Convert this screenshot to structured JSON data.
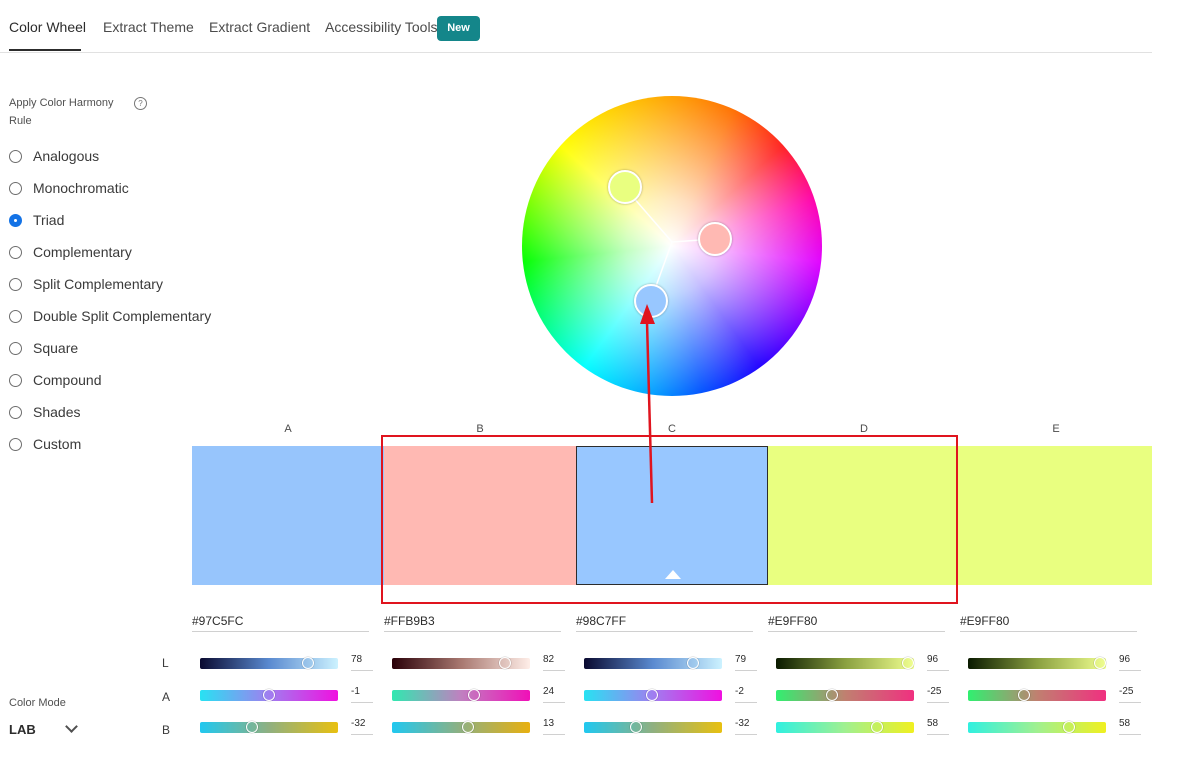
{
  "tabs": [
    {
      "label": "Color Wheel",
      "active": true
    },
    {
      "label": "Extract Theme",
      "active": false
    },
    {
      "label": "Extract Gradient",
      "active": false
    },
    {
      "label": "Accessibility Tools",
      "active": false
    }
  ],
  "tabs_badge": "New",
  "harmony": {
    "label": "Apply Color Harmony Rule",
    "help_icon": "question-circle-icon",
    "selected": "Triad",
    "rules": [
      "Analogous",
      "Monochromatic",
      "Triad",
      "Complementary",
      "Split Complementary",
      "Double Split Complementary",
      "Square",
      "Compound",
      "Shades",
      "Custom"
    ]
  },
  "swatches": [
    {
      "letter": "A",
      "hex": "#97C5FC",
      "color": "#97C5FC",
      "L": 78,
      "A": -1,
      "B": -32
    },
    {
      "letter": "B",
      "hex": "#FFB9B3",
      "color": "#FFB9B3",
      "L": 82,
      "A": 24,
      "B": 13
    },
    {
      "letter": "C",
      "hex": "#98C7FF",
      "color": "#98C7FF",
      "L": 79,
      "A": -2,
      "B": -32
    },
    {
      "letter": "D",
      "hex": "#E9FF80",
      "color": "#E9FF80",
      "L": 96,
      "A": -25,
      "B": 58
    },
    {
      "letter": "E",
      "hex": "#E9FF80",
      "color": "#E9FF80",
      "L": 96,
      "A": -25,
      "B": 58
    }
  ],
  "selected_swatch": "C",
  "channel_labels": [
    "L",
    "A",
    "B"
  ],
  "color_mode": {
    "label": "Color Mode",
    "value": "LAB"
  },
  "colors": {
    "accent": "#1473e6",
    "badge": "#14868a",
    "annotation": "#e0141e"
  }
}
